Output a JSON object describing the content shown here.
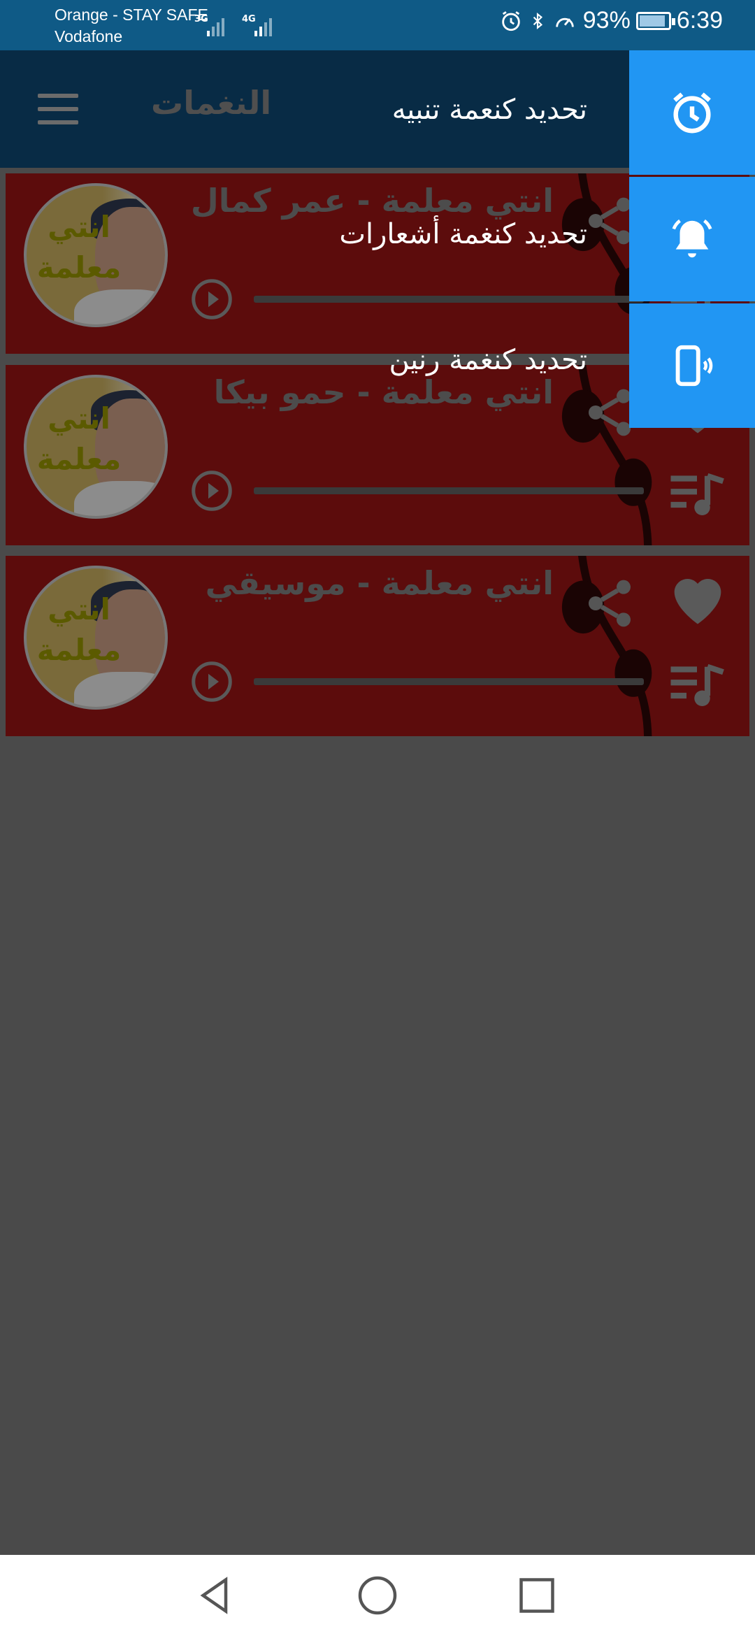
{
  "status_bar": {
    "carrier_1": "Orange - STAY SAFE",
    "carrier_2": "Vodafone",
    "network_1": "3G",
    "network_2": "4G",
    "battery": "93%",
    "time": "6:39",
    "icons": [
      "alarm-icon",
      "bluetooth-icon",
      "speed-icon",
      "battery-icon"
    ]
  },
  "app_bar": {
    "title": "النغمات",
    "menu_icon": "hamburger-icon"
  },
  "tracks": [
    {
      "title": "انتي معلمة - عمر كمال",
      "thumb_label": "انتي معلمة"
    },
    {
      "title": "انتي معلمة - حمو بيكا",
      "thumb_label": "انتي معلمة"
    },
    {
      "title": "انتي معلمة - موسيقي",
      "thumb_label": "انتي معلمة"
    }
  ],
  "set_as_menu": [
    {
      "label": "تحديد كنعمة تنبيه",
      "icon": "alarm-clock-icon"
    },
    {
      "label": "تحديد كنغمة أشعارات",
      "icon": "bell-icon"
    },
    {
      "label": "تحديد كنغمة رنين",
      "icon": "phone-vibrate-icon"
    }
  ],
  "colors": {
    "fab": "#2196f3",
    "status_bar": "#0f5a86",
    "app_bar": "#082b45",
    "card": "#5c0c0c",
    "scrim": "#4a4a4a"
  },
  "nav": [
    "back-icon",
    "home-icon",
    "recents-icon"
  ]
}
